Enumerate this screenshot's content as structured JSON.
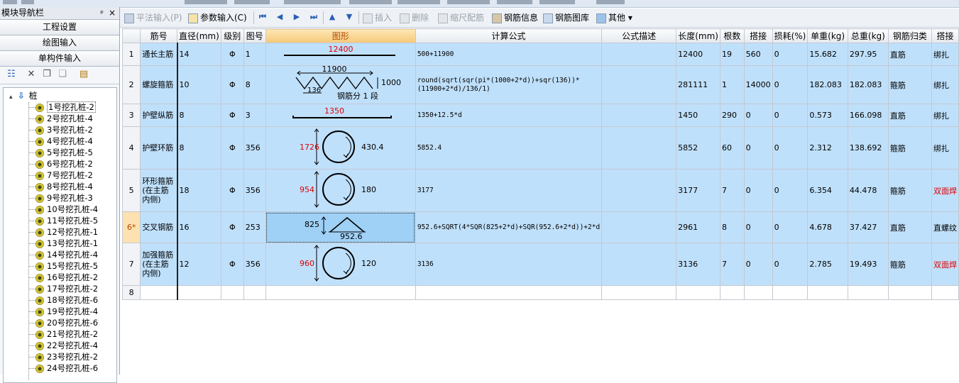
{
  "left_panel": {
    "title": "模块导航栏",
    "pin": "ᵖ",
    "close": "×",
    "nav_buttons": [
      "工程设置",
      "绘图输入",
      "单构件输入"
    ],
    "tree": {
      "root": "桩",
      "items": [
        "1号挖孔桩-2",
        "2号挖孔桩-4",
        "3号挖孔桩-2",
        "4号挖孔桩-4",
        "5号挖孔桩-5",
        "6号挖孔桩-2",
        "7号挖孔桩-2",
        "8号挖孔桩-4",
        "9号挖孔桩-3",
        "10号挖孔桩-4",
        "11号挖孔桩-5",
        "12号挖孔桩-1",
        "13号挖孔桩-1",
        "14号挖孔桩-4",
        "15号挖孔桩-5",
        "16号挖孔桩-2",
        "17号挖孔桩-2",
        "18号挖孔桩-6",
        "19号挖孔桩-4",
        "20号挖孔桩-6",
        "21号挖孔桩-2",
        "22号挖孔桩-4",
        "23号挖孔桩-2",
        "24号挖孔桩-6"
      ],
      "selected_index": 0
    }
  },
  "toolbar": {
    "flat_input": "平法输入(P)",
    "param_input": "参数输入(C)",
    "insert": "插入",
    "delete": "删除",
    "scale_config": "缩尺配筋",
    "rebar_info": "钢筋信息",
    "rebar_library": "钢筋图库",
    "other": "其他",
    "nav_first": "⏮",
    "nav_prev": "◀",
    "nav_next": "▶",
    "nav_last": "⏭",
    "move_up": "▲",
    "move_down": "▼"
  },
  "grid": {
    "columns": [
      "筋号",
      "直径(mm)",
      "级别",
      "图号",
      "图形",
      "计算公式",
      "公式描述",
      "长度(mm)",
      "根数",
      "搭接",
      "损耗(%)",
      "单重(kg)",
      "总重(kg)",
      "钢筋归类",
      "搭接"
    ],
    "rows": [
      {
        "no": "1",
        "name": "通长主筋",
        "dia": "14",
        "grade": "Φ",
        "fig": "1",
        "formula": "500+11900",
        "desc": "",
        "length": "12400",
        "count": "19",
        "lap": "560",
        "loss": "0",
        "unit_w": "15.682",
        "total_w": "297.95",
        "category": "直筋",
        "lap_type": "绑扎",
        "lap_red": false
      },
      {
        "no": "2",
        "name": "螺旋箍筋",
        "dia": "10",
        "grade": "Φ",
        "fig": "8",
        "formula": "round(sqrt(sqr(pi*(1000+2*d))+sqr(136))*(11900+2*d)/136/1)",
        "desc": "",
        "length": "281111",
        "count": "1",
        "lap": "14000",
        "loss": "0",
        "unit_w": "182.083",
        "total_w": "182.083",
        "category": "箍筋",
        "lap_type": "绑扎",
        "lap_red": false
      },
      {
        "no": "3",
        "name": "护壁纵筋",
        "dia": "8",
        "grade": "Φ",
        "fig": "3",
        "formula": "1350+12.5*d",
        "desc": "",
        "length": "1450",
        "count": "290",
        "lap": "0",
        "loss": "0",
        "unit_w": "0.573",
        "total_w": "166.098",
        "category": "直筋",
        "lap_type": "绑扎",
        "lap_red": false
      },
      {
        "no": "4",
        "name": "护壁环筋",
        "dia": "8",
        "grade": "Φ",
        "fig": "356",
        "formula": "5852.4",
        "desc": "",
        "length": "5852",
        "count": "60",
        "lap": "0",
        "loss": "0",
        "unit_w": "2.312",
        "total_w": "138.692",
        "category": "箍筋",
        "lap_type": "绑扎",
        "lap_red": false
      },
      {
        "no": "5",
        "name": "环形箍筋(在主筋内侧)",
        "dia": "18",
        "grade": "Φ",
        "fig": "356",
        "formula": "3177",
        "desc": "",
        "length": "3177",
        "count": "7",
        "lap": "0",
        "loss": "0",
        "unit_w": "6.354",
        "total_w": "44.478",
        "category": "箍筋",
        "lap_type": "双面焊",
        "lap_red": true
      },
      {
        "no": "6*",
        "name": "交叉钢筋",
        "dia": "16",
        "grade": "Φ",
        "fig": "253",
        "formula": "952.6+SQRT(4*SQR(825+2*d)+SQR(952.6+2*d))+2*d",
        "desc": "",
        "length": "2961",
        "count": "8",
        "lap": "0",
        "loss": "0",
        "unit_w": "4.678",
        "total_w": "37.427",
        "category": "直筋",
        "lap_type": "直螺纹",
        "lap_red": false
      },
      {
        "no": "7",
        "name": "加强箍筋(在主筋内侧)",
        "dia": "12",
        "grade": "Φ",
        "fig": "356",
        "formula": "3136",
        "desc": "",
        "length": "3136",
        "count": "7",
        "lap": "0",
        "loss": "0",
        "unit_w": "2.785",
        "total_w": "19.493",
        "category": "箍筋",
        "lap_type": "双面焊",
        "lap_red": true
      },
      {
        "no": "8",
        "name": "",
        "dia": "",
        "grade": "",
        "fig": "",
        "formula": "",
        "desc": "",
        "length": "",
        "count": "",
        "lap": "",
        "loss": "",
        "unit_w": "",
        "total_w": "",
        "category": "",
        "lap_type": "",
        "lap_red": false
      }
    ],
    "current_row": 5
  },
  "shapes": {
    "r1": {
      "len": "12400"
    },
    "r2": {
      "len": "11900",
      "height": "1000",
      "pitch": "136",
      "seg": "钢筋分 1 段"
    },
    "r3": {
      "len": "1350"
    },
    "r4": {
      "d": "1726",
      "v": "430.4"
    },
    "r5": {
      "d": "954",
      "v": "180"
    },
    "r6": {
      "h": "825",
      "w": "952.6"
    },
    "r7": {
      "d": "960",
      "v": "120"
    }
  },
  "colors": {
    "row_bg": "#bfe0fb",
    "header_highlight": "#f6c87a",
    "dim_red": "#e00000",
    "accent_blue": "#2a5fb0"
  }
}
